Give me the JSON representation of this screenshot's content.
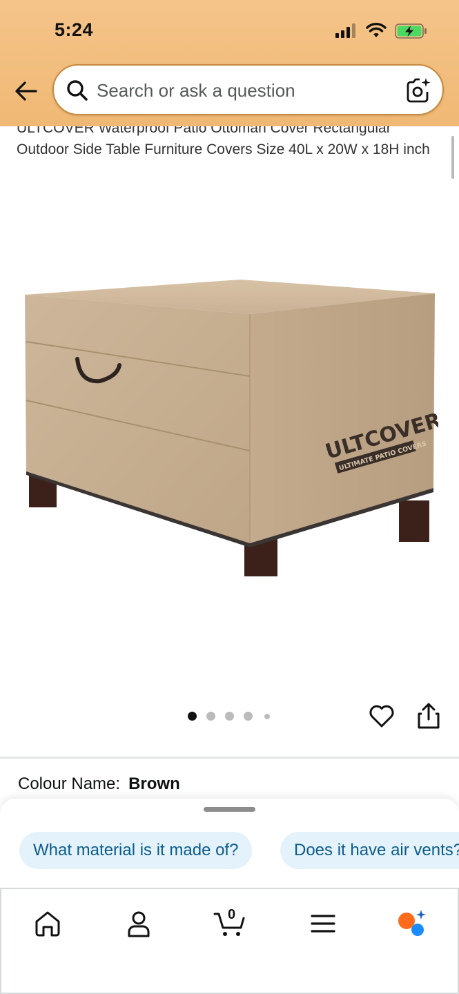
{
  "status_bar": {
    "time": "5:24",
    "icons": [
      "signal-icon",
      "wifi-icon",
      "battery-charging-icon"
    ],
    "battery_color": "#4bd964"
  },
  "header": {
    "background": "#f0b874",
    "back_icon": "back-arrow-icon",
    "search": {
      "placeholder": "Search or ask a question",
      "value": "",
      "search_icon": "search-icon",
      "camera_icon": "camera-scan-icon"
    }
  },
  "product": {
    "title": "ULTCOVER Waterproof Patio Ottoman Cover Rectangular Outdoor Side Table Furniture Covers Size 40L x 20W x 18H inch",
    "image": {
      "brand_logo_text": "ULTCOVER",
      "brand_tagline": "ULTIMATE PATIO COVERS"
    },
    "carousel": {
      "total_dots": 5,
      "active_index": 0
    },
    "actions": {
      "wishlist_icon": "heart-icon",
      "share_icon": "share-icon"
    },
    "colour": {
      "label": "Colour Name:",
      "value": "Brown"
    }
  },
  "suggestions": {
    "chips": [
      "What material is it made of?",
      "Does it have air vents?"
    ],
    "chip_color": "#e4f2fb",
    "chip_text_color": "#0a5c8c"
  },
  "bottom_nav": {
    "items": [
      {
        "name": "home",
        "icon": "home-icon"
      },
      {
        "name": "account",
        "icon": "user-icon"
      },
      {
        "name": "cart",
        "icon": "cart-icon",
        "count": "0"
      },
      {
        "name": "menu",
        "icon": "menu-icon"
      },
      {
        "name": "rufus",
        "icon": "rufus-assistant-icon"
      }
    ]
  }
}
